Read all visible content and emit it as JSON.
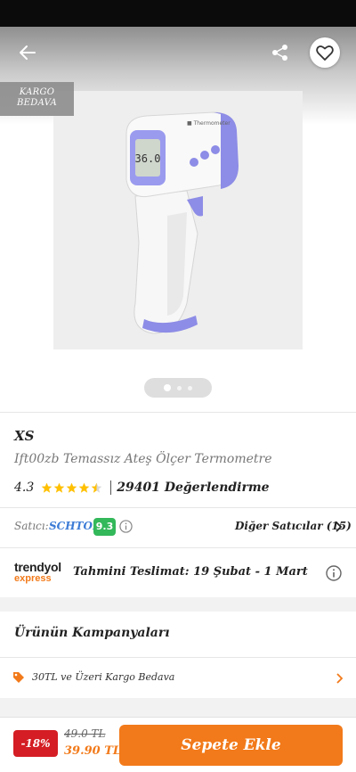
{
  "header": {
    "back_icon": "arrow-left-icon",
    "share_icon": "share-icon",
    "favorite_icon": "heart-icon"
  },
  "gallery": {
    "badge_line1": "KARGO",
    "badge_line2": "BEDAVA",
    "image_count": 3,
    "active_index": 0
  },
  "product": {
    "brand": "XS",
    "name": "Ift00zb Temassız Ateş Ölçer Termometre",
    "rating": "4.3",
    "rating_value": 4.3,
    "review_count": "29401 Değerlendirme"
  },
  "seller": {
    "label": "Satıcı:",
    "name": "SCHTOK",
    "score": "9.3",
    "other_sellers": "Diğer Satıcılar (15)"
  },
  "delivery": {
    "logo_top": "trendyol",
    "logo_bottom": "express",
    "text": "Tahmini Teslimat: 19 Şubat - 1 Mart"
  },
  "campaigns": {
    "title": "Ürünün Kampanyaları",
    "items": [
      {
        "label": "30TL ve Üzeri Kargo Bedava"
      }
    ]
  },
  "purchase": {
    "discount": "-18%",
    "old_price": "49.0 TL",
    "new_price": "39.90 TL",
    "cart_label": "Sepete Ekle"
  },
  "colors": {
    "accent": "#f27a1a",
    "discount": "#d41d24",
    "seller_score": "#33b85a",
    "seller_link": "#3b7bd6"
  }
}
